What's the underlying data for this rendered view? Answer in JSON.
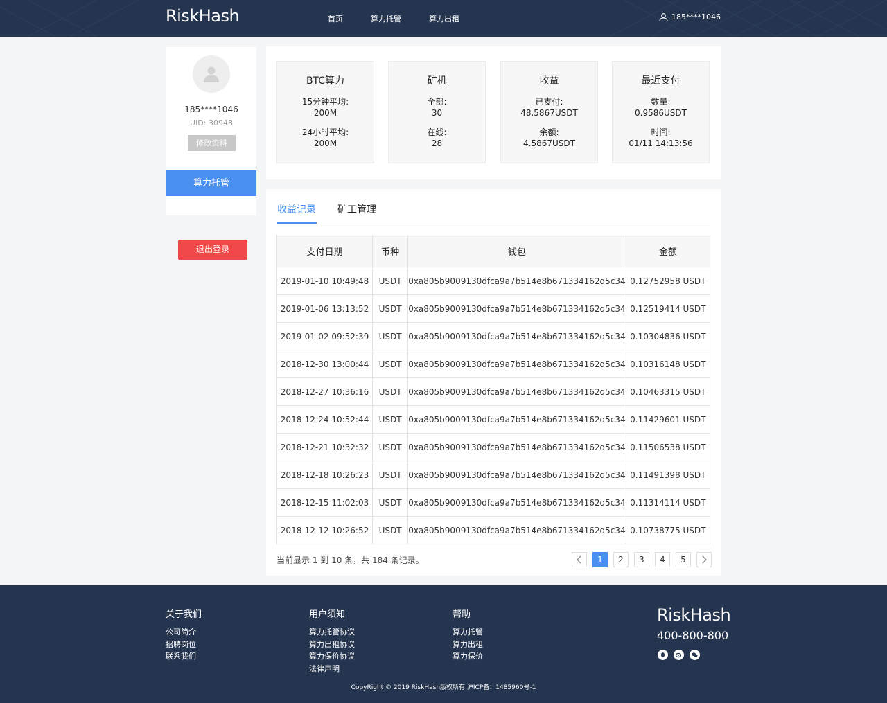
{
  "header": {
    "logo": "RiskHash",
    "nav": [
      "首页",
      "算力托管",
      "算力出租"
    ],
    "user": "185****1046"
  },
  "profile": {
    "name": "185****1046",
    "uid": "UID: 30948",
    "edit_label": "修改资料",
    "hosting_label": "算力托管",
    "logout_label": "退出登录"
  },
  "stats": [
    {
      "title": "BTC算力",
      "l1": "15分钟平均:",
      "v1": "200M",
      "l2": "24小时平均:",
      "v2": "200M"
    },
    {
      "title": "矿机",
      "l1": "全部:",
      "v1": "30",
      "l2": "在线:",
      "v2": "28"
    },
    {
      "title": "收益",
      "l1": "已支付:",
      "v1": "48.5867USDT",
      "l2": "余额:",
      "v2": "4.5867USDT"
    },
    {
      "title": "最近支付",
      "l1": "数量:",
      "v1": "0.9586USDT",
      "l2": "时间:",
      "v2": "01/11 14:13:56"
    }
  ],
  "tabs": {
    "active": "收益记录",
    "second": "矿工管理"
  },
  "table": {
    "headers": [
      "支付日期",
      "币种",
      "钱包",
      "金额"
    ],
    "rows": [
      [
        "2019-01-10 10:49:48",
        "USDT",
        "0xa805b9009130dfca9a7b514e8b671334162d5c34",
        "0.12752958  USDT"
      ],
      [
        "2019-01-06 13:13:52",
        "USDT",
        "0xa805b9009130dfca9a7b514e8b671334162d5c34",
        "0.12519414  USDT"
      ],
      [
        "2019-01-02 09:52:39",
        "USDT",
        "0xa805b9009130dfca9a7b514e8b671334162d5c34",
        "0.10304836  USDT"
      ],
      [
        "2018-12-30 13:00:44",
        "USDT",
        "0xa805b9009130dfca9a7b514e8b671334162d5c34",
        "0.10316148  USDT"
      ],
      [
        "2018-12-27 10:36:16",
        "USDT",
        "0xa805b9009130dfca9a7b514e8b671334162d5c34",
        "0.10463315  USDT"
      ],
      [
        "2018-12-24 10:52:44",
        "USDT",
        "0xa805b9009130dfca9a7b514e8b671334162d5c34",
        "0.11429601  USDT"
      ],
      [
        "2018-12-21 10:32:32",
        "USDT",
        "0xa805b9009130dfca9a7b514e8b671334162d5c34",
        "0.11506538  USDT"
      ],
      [
        "2018-12-18 10:26:23",
        "USDT",
        "0xa805b9009130dfca9a7b514e8b671334162d5c34",
        "0.11491398  USDT"
      ],
      [
        "2018-12-15 11:02:03",
        "USDT",
        "0xa805b9009130dfca9a7b514e8b671334162d5c34",
        "0.11314114  USDT"
      ],
      [
        "2018-12-12 10:26:52",
        "USDT",
        "0xa805b9009130dfca9a7b514e8b671334162d5c34",
        "0.10738775  USDT"
      ]
    ]
  },
  "pagination": {
    "info": "当前显示 1 到 10 条，共 184 条记录。",
    "prev": "‹",
    "pages": [
      "1",
      "2",
      "3",
      "4",
      "5"
    ],
    "next": "›"
  },
  "footer": {
    "col1": {
      "title": "关于我们",
      "links": [
        "公司简介",
        "招聘岗位",
        "联系我们"
      ]
    },
    "col2": {
      "title": "用户须知",
      "links": [
        "算力托管协议",
        "算力出租协议",
        "算力保价协议",
        "法律声明"
      ]
    },
    "col3": {
      "title": "帮助",
      "links": [
        "算力托管",
        "算力出租",
        "算力保价"
      ]
    },
    "logo": "RiskHash",
    "phone": "400-800-800",
    "social_icons": [
      "qq-icon",
      "weibo-icon",
      "wechat-icon"
    ],
    "copyright": "CopyRight © 2019 RiskHash版权所有  沪ICP备：1485960号-1"
  },
  "colors": {
    "accent": "#4a90f0",
    "header": "#25354f",
    "danger": "#f04848"
  }
}
